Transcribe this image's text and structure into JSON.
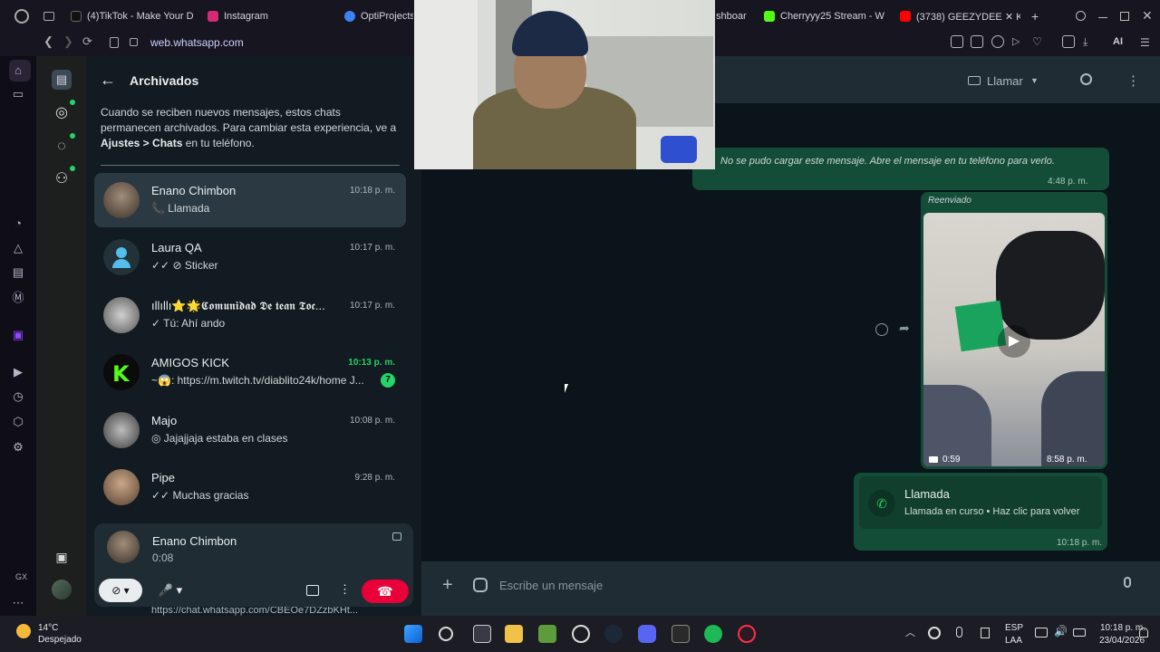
{
  "browser": {
    "tabs": [
      {
        "label": "(4)TikTok - Make Your D",
        "color": "#111111"
      },
      {
        "label": "Instagram",
        "color": "#d62976"
      },
      {
        "label": "OptiProjects",
        "color": "#3b82f6"
      },
      {
        "label": "shboar",
        "color": "#555555"
      },
      {
        "label": "Cherryyy25 Stream - W",
        "color": "#53fc18"
      },
      {
        "label": "(3738) GEEZYDEE ✕ KI",
        "color": "#ff0000"
      }
    ],
    "url": "web.whatsapp.com",
    "ai_label": "AI"
  },
  "archived": {
    "title": "Archivados",
    "note_prefix": "Cuando se reciben nuevos mensajes, estos chats permanecen archivados. Para cambiar esta experiencia, ve a",
    "note_bold": "Ajustes > Chats",
    "note_suffix": "en tu teléfono."
  },
  "chats": [
    {
      "name": "Enano Chimbon",
      "time": "10:18 p. m.",
      "preview": "📞 Llamada",
      "active": true
    },
    {
      "name": "Laura QA",
      "time": "10:17 p. m.",
      "preview": "✓✓ ⊘ Sticker"
    },
    {
      "name": "ıllıllı⭐🌟𝕮𝖔𝖒𝖚𝖓𝖎𝖉𝖆𝖉 𝕯𝖊 𝖙𝖊𝖆𝖓 𝕿𝖔𝖈...",
      "time": "10:17 p. m.",
      "preview": "✓ Tú: Ahí ando"
    },
    {
      "name": "AMIGOS KICK",
      "time": "10:13 p. m.",
      "preview": "~😱: https://m.twitch.tv/diablito24k/home J...",
      "unread": "7"
    },
    {
      "name": "Majo",
      "time": "10:08 p. m.",
      "preview": "◎ Jajajjaja estaba en clases"
    },
    {
      "name": "Pipe",
      "time": "9:28 p. m.",
      "preview": "✓✓ Muchas gracias"
    }
  ],
  "call": {
    "name": "Enano Chimbon",
    "timer": "0:08",
    "under_text": "https://chat.whatsapp.com/CBEOe7DZzbKHt..."
  },
  "conversation": {
    "header_call": "Llamar",
    "error_message": "No se pudo cargar este mensaje. Abre el mensaje en tu teléfono para verlo.",
    "error_time": "4:48 p. m.",
    "forwarded_label": "Reenviado",
    "video_duration": "0:59",
    "video_time": "8:58 p. m.",
    "call_title": "Llamada",
    "call_subtitle": "Llamada en curso • Haz clic para volver",
    "call_time": "10:18 p. m.",
    "composer_placeholder": "Escribe un mensaje"
  },
  "taskbar": {
    "weather_temp": "14°C",
    "weather_desc": "Despejado",
    "lang_top": "ESP",
    "lang_bottom": "LAA",
    "clock_time": "10:18 p. m.",
    "clock_date": "23/04/2026"
  }
}
